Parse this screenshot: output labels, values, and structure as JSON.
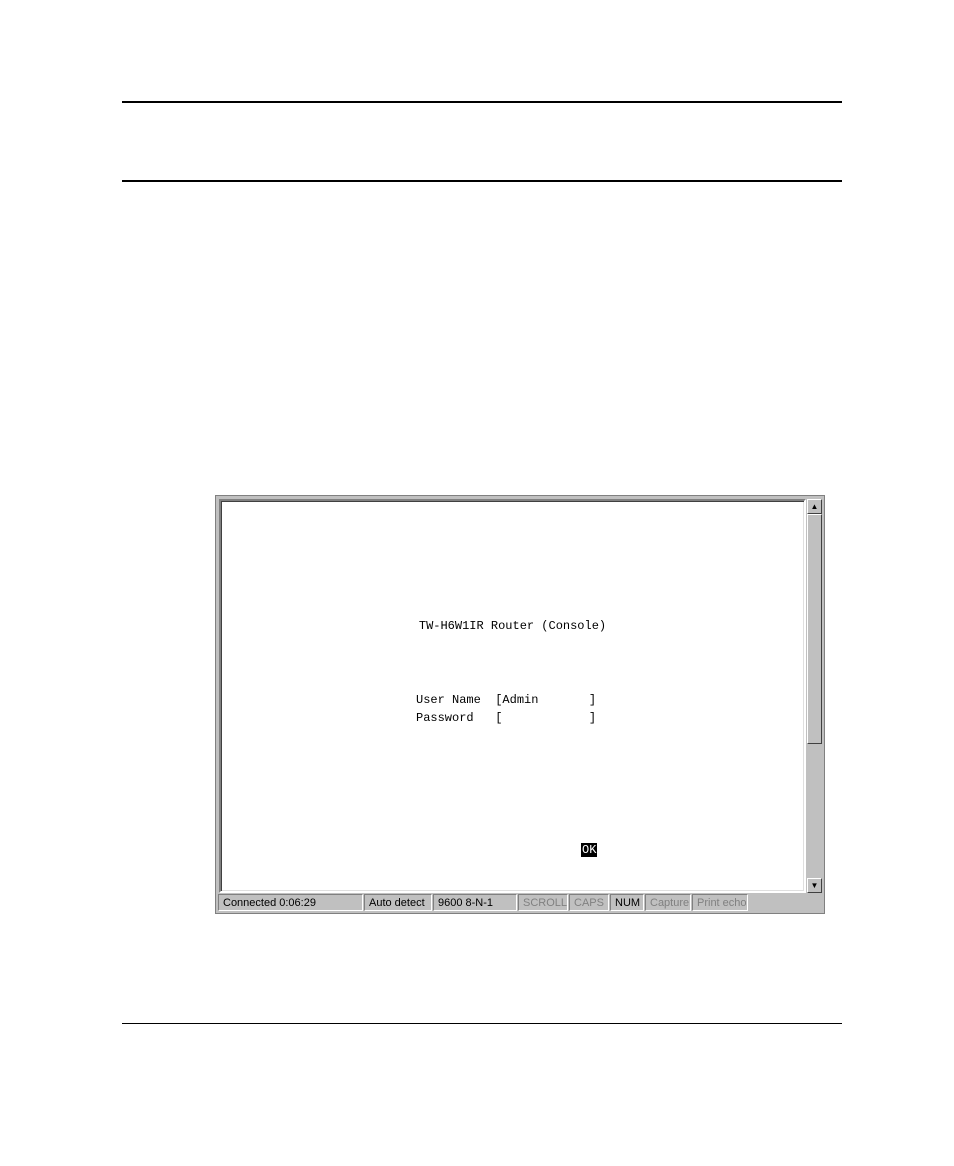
{
  "terminal": {
    "title": "TW-H6W1IR Router (Console)",
    "username_label": "User Name",
    "username_value": "Admin",
    "password_label": "Password",
    "password_value": "",
    "ok_label": "OK"
  },
  "statusbar": {
    "connected": "Connected 0:06:29",
    "detect": "Auto detect",
    "baud": "9600 8-N-1",
    "scroll": "SCROLL",
    "caps": "CAPS",
    "num": "NUM",
    "capture": "Capture",
    "printecho": "Print echo"
  }
}
